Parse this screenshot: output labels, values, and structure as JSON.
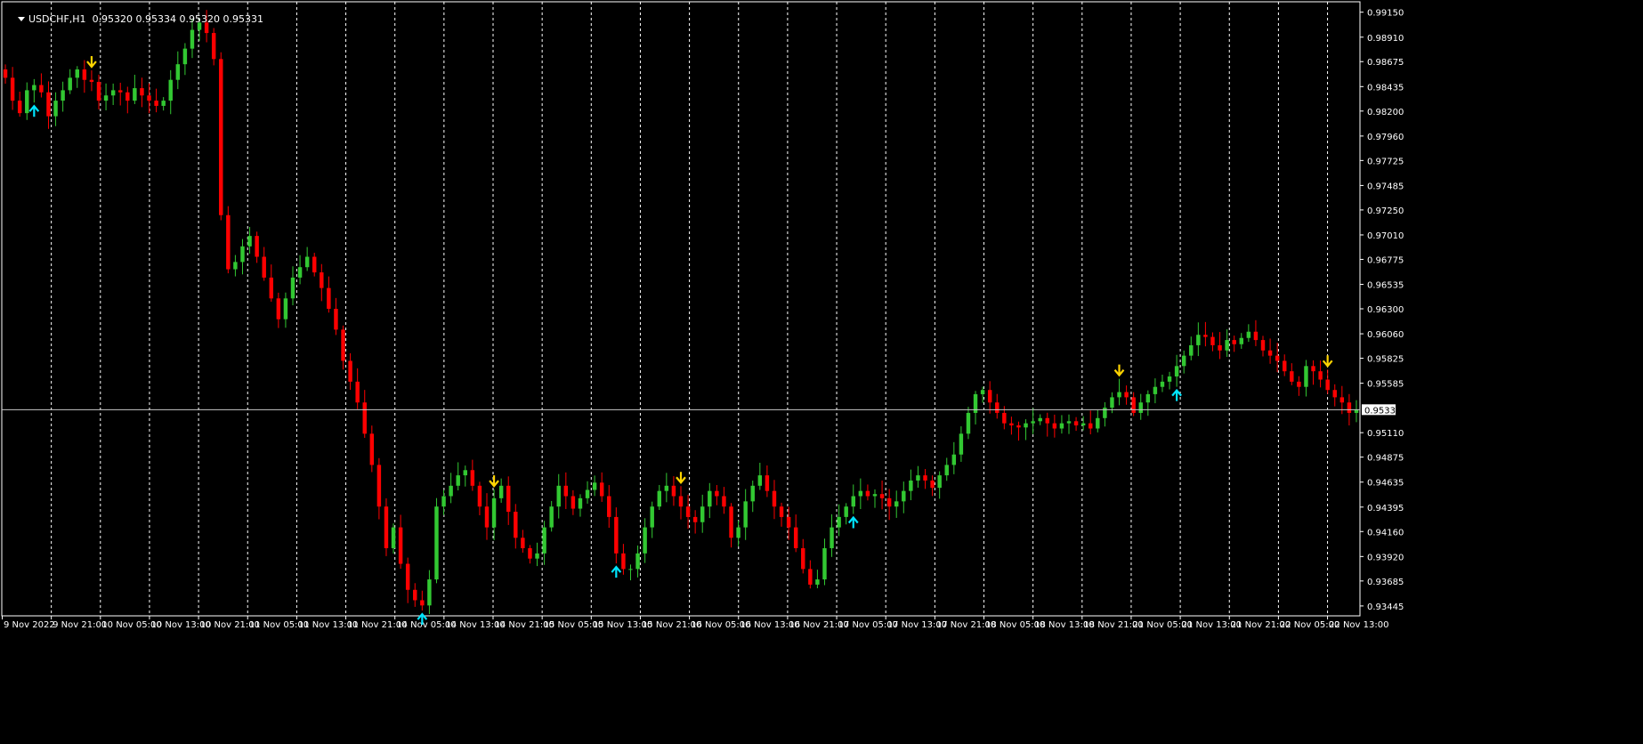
{
  "window": {
    "symbol": "USDCHF,H1",
    "ohlc": "0.95320 0.95334 0.95320 0.95331"
  },
  "price_axis": {
    "labels": [
      "0.99150",
      "0.98910",
      "0.98675",
      "0.98435",
      "0.98200",
      "0.97960",
      "0.97725",
      "0.97485",
      "0.97250",
      "0.97010",
      "0.96775",
      "0.96535",
      "0.96300",
      "0.96060",
      "0.95825",
      "0.95585",
      "0.95110",
      "0.94875",
      "0.94635",
      "0.94395",
      "0.94160",
      "0.93920",
      "0.93685",
      "0.93445"
    ],
    "current_price": "0.95331"
  },
  "time_axis": {
    "labels": [
      "9 Nov 2022",
      "9 Nov 21:00",
      "10 Nov 05:00",
      "10 Nov 13:00",
      "10 Nov 21:00",
      "11 Nov 05:00",
      "11 Nov 13:00",
      "11 Nov 21:00",
      "14 Nov 05:00",
      "14 Nov 13:00",
      "14 Nov 21:00",
      "15 Nov 05:00",
      "15 Nov 13:00",
      "15 Nov 21:00",
      "16 Nov 05:00",
      "16 Nov 13:00",
      "16 Nov 21:00",
      "17 Nov 05:00",
      "17 Nov 13:00",
      "17 Nov 21:00",
      "18 Nov 05:00",
      "18 Nov 13:00",
      "18 Nov 21:00",
      "21 Nov 05:00",
      "21 Nov 13:00",
      "21 Nov 21:00",
      "22 Nov 05:00",
      "22 Nov 13:00"
    ]
  },
  "colors": {
    "background": "#000000",
    "bull": "#32c832",
    "bear": "#ff0000",
    "up_arrow": "#00e5ff",
    "down_arrow": "#ffd400",
    "grid": "#ffffff",
    "axis_text": "#ffffff"
  },
  "chart_data": {
    "type": "candlestick",
    "symbol": "USDCHF",
    "timeframe": "H1",
    "ylim": [
      0.9335,
      0.9925
    ],
    "grid": "vertical dashed separators",
    "current_price": 0.95331,
    "series": [
      {
        "name": "close",
        "values": [
          0.9852,
          0.983,
          0.9818,
          0.984,
          0.9845,
          0.9838,
          0.9815,
          0.983,
          0.984,
          0.9852,
          0.986,
          0.985,
          0.9848,
          0.983,
          0.9835,
          0.984,
          0.9838,
          0.983,
          0.9842,
          0.9835,
          0.983,
          0.9825,
          0.983,
          0.985,
          0.9865,
          0.988,
          0.9898,
          0.9905,
          0.9895,
          0.987,
          0.972,
          0.9668,
          0.9675,
          0.969,
          0.97,
          0.968,
          0.966,
          0.964,
          0.962,
          0.964,
          0.966,
          0.967,
          0.968,
          0.9665,
          0.965,
          0.963,
          0.961,
          0.958,
          0.956,
          0.954,
          0.951,
          0.948,
          0.944,
          0.94,
          0.942,
          0.9385,
          0.936,
          0.935,
          0.9345,
          0.937,
          0.944,
          0.945,
          0.946,
          0.947,
          0.9475,
          0.946,
          0.944,
          0.942,
          0.9448,
          0.946,
          0.9435,
          0.941,
          0.94,
          0.939,
          0.9395,
          0.942,
          0.944,
          0.946,
          0.945,
          0.9438,
          0.9448,
          0.9456,
          0.9463,
          0.945,
          0.943,
          0.9395,
          0.938,
          0.938,
          0.9395,
          0.942,
          0.944,
          0.9455,
          0.946,
          0.945,
          0.944,
          0.943,
          0.9425,
          0.944,
          0.9455,
          0.945,
          0.944,
          0.941,
          0.942,
          0.9445,
          0.946,
          0.947,
          0.9455,
          0.944,
          0.943,
          0.942,
          0.94,
          0.938,
          0.9365,
          0.937,
          0.94,
          0.942,
          0.943,
          0.944,
          0.945,
          0.9455,
          0.945,
          0.9452,
          0.9448,
          0.944,
          0.9445,
          0.9455,
          0.9465,
          0.947,
          0.9465,
          0.9458,
          0.947,
          0.948,
          0.949,
          0.951,
          0.953,
          0.9548,
          0.9552,
          0.954,
          0.953,
          0.952,
          0.9518,
          0.9516,
          0.952,
          0.9522,
          0.9525,
          0.952,
          0.9515,
          0.952,
          0.9522,
          0.9518,
          0.952,
          0.9515,
          0.9525,
          0.9535,
          0.9545,
          0.955,
          0.9545,
          0.953,
          0.954,
          0.9548,
          0.9555,
          0.956,
          0.9565,
          0.9575,
          0.9585,
          0.9595,
          0.9605,
          0.9603,
          0.9595,
          0.959,
          0.96,
          0.9596,
          0.9602,
          0.9608,
          0.96,
          0.959,
          0.9585,
          0.958,
          0.957,
          0.956,
          0.9555,
          0.9575,
          0.957,
          0.9562,
          0.9552,
          0.9545,
          0.954,
          0.953,
          0.9533
        ]
      }
    ],
    "signals": [
      {
        "type": "buy",
        "label": "up-arrow",
        "candle_index": 4
      },
      {
        "type": "sell",
        "label": "down-arrow",
        "candle_index": 12
      },
      {
        "type": "buy",
        "label": "up-arrow",
        "candle_index": 58
      },
      {
        "type": "sell",
        "label": "down-arrow",
        "candle_index": 68
      },
      {
        "type": "buy",
        "label": "up-arrow",
        "candle_index": 85
      },
      {
        "type": "sell",
        "label": "down-arrow",
        "candle_index": 94
      },
      {
        "type": "buy",
        "label": "up-arrow",
        "candle_index": 118
      },
      {
        "type": "sell",
        "label": "down-arrow",
        "candle_index": 155
      },
      {
        "type": "buy",
        "label": "up-arrow",
        "candle_index": 163
      },
      {
        "type": "sell",
        "label": "down-arrow",
        "candle_index": 184
      }
    ]
  }
}
